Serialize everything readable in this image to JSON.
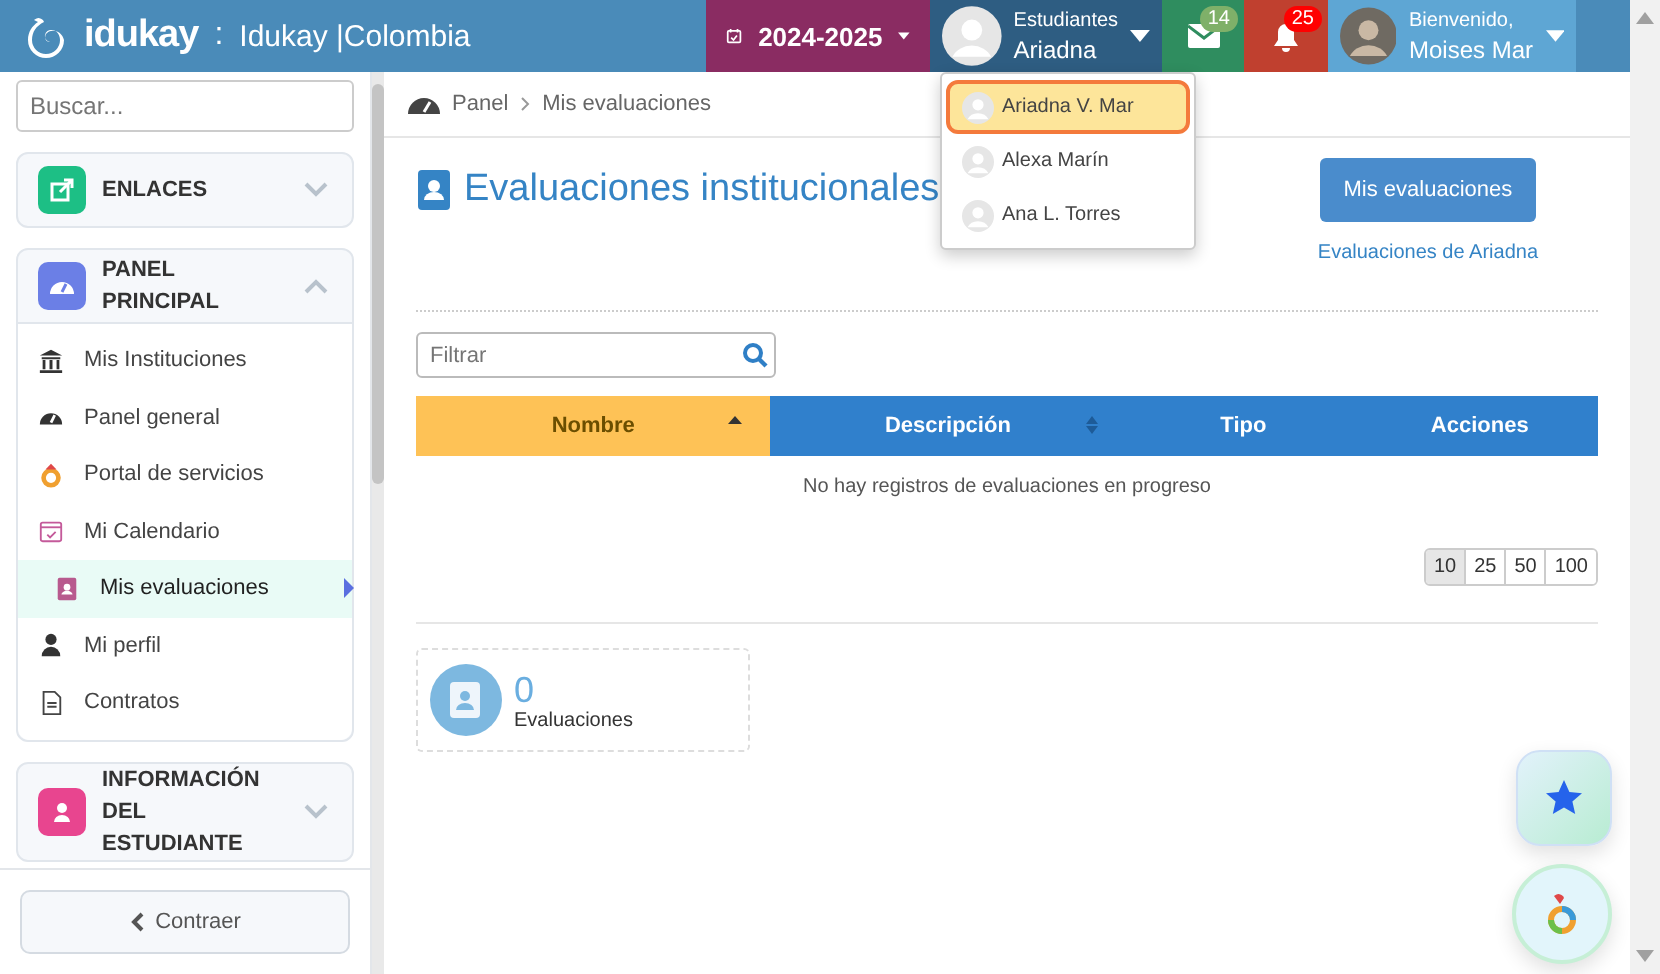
{
  "header": {
    "brand": "idukay",
    "separator": ":",
    "school": "Idukay |Colombia",
    "year": "2024-2025",
    "students": {
      "label": "Estudiantes",
      "name": "Ariadna"
    },
    "messages": {
      "count": "14"
    },
    "notifications": {
      "count": "25"
    },
    "user": {
      "greeting": "Bienvenido,",
      "name": "Moises Mar"
    }
  },
  "student_menu": [
    {
      "name": "Ariadna V. Mar",
      "selected": true
    },
    {
      "name": "Alexa Marín",
      "selected": false
    },
    {
      "name": "Ana L. Torres",
      "selected": false
    }
  ],
  "sidebar": {
    "search": {
      "placeholder": "Buscar..."
    },
    "sections": [
      {
        "title": "ENLACES",
        "color": "#1dbf85",
        "expanded": false
      },
      {
        "title": "PANEL PRINCIPAL",
        "color": "#6b7fe6",
        "expanded": true,
        "items": [
          {
            "label": "Mis Instituciones",
            "selected": false
          },
          {
            "label": "Panel general",
            "selected": false
          },
          {
            "label": "Portal de servicios",
            "selected": false
          },
          {
            "label": "Mi Calendario",
            "selected": false
          },
          {
            "label": "Mis evaluaciones",
            "selected": true
          },
          {
            "label": "Mi perfil",
            "selected": false
          },
          {
            "label": "Contratos",
            "selected": false
          }
        ]
      },
      {
        "title": "INFORMACIÓN DEL ESTUDIANTE",
        "color": "#e8458f",
        "expanded": false
      }
    ],
    "collapse": "Contraer"
  },
  "breadcrumb": [
    "Panel",
    "Mis evaluaciones"
  ],
  "page": {
    "title": "Evaluaciones institucionales",
    "button": "Mis evaluaciones",
    "link": "Evaluaciones de Ariadna",
    "filter": {
      "placeholder": "Filtrar"
    },
    "table": {
      "columns": [
        {
          "label": "Nombre",
          "sorted": true,
          "sortable": true
        },
        {
          "label": "Descripción",
          "sorted": false,
          "sortable": true
        },
        {
          "label": "Tipo",
          "sorted": false,
          "sortable": false
        },
        {
          "label": "Acciones",
          "sorted": false,
          "sortable": false
        }
      ],
      "empty": "No hay registros de evaluaciones en progreso"
    },
    "page_sizes": [
      {
        "label": "10",
        "selected": true
      },
      {
        "label": "25",
        "selected": false
      },
      {
        "label": "50",
        "selected": false
      },
      {
        "label": "100",
        "selected": false
      }
    ],
    "summary": {
      "count": "0",
      "label": "Evaluaciones"
    }
  }
}
